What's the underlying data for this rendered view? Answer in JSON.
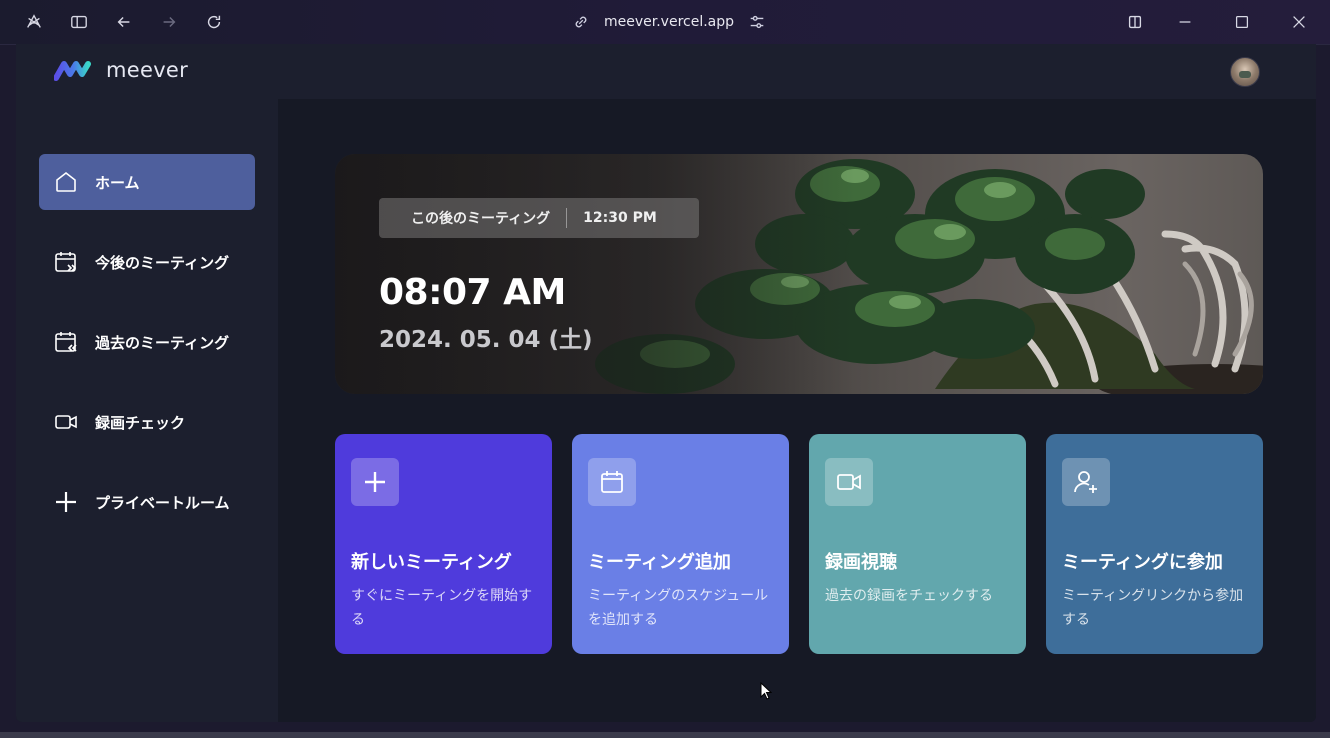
{
  "browser": {
    "url": "meever.vercel.app"
  },
  "app": {
    "name": "meever",
    "brand_colors": [
      "#5b4ee6",
      "#3ad6c8"
    ]
  },
  "sidebar": {
    "items": [
      {
        "label": "ホーム",
        "icon": "home-icon",
        "active": true
      },
      {
        "label": "今後のミーティング",
        "icon": "calendar-forward-icon",
        "active": false
      },
      {
        "label": "過去のミーティング",
        "icon": "calendar-back-icon",
        "active": false
      },
      {
        "label": "録画チェック",
        "icon": "video-icon",
        "active": false
      },
      {
        "label": "プライベートルーム",
        "icon": "plus-icon",
        "active": false
      }
    ]
  },
  "hero": {
    "upcoming_label": "この後のミーティング",
    "upcoming_time": "12:30 PM",
    "current_time": "08:07 AM",
    "current_date": "2024. 05. 04 (土)"
  },
  "cards": [
    {
      "title": "新しいミーティング",
      "description": "すぐにミーティングを開始する",
      "icon": "plus-icon",
      "color": "#4f3bdc"
    },
    {
      "title": "ミーティング追加",
      "description": "ミーティングのスケジュールを追加する",
      "icon": "calendar-icon",
      "color": "#6a7fe6"
    },
    {
      "title": "録画視聴",
      "description": "過去の録画をチェックする",
      "icon": "video-icon",
      "color": "#62a7ad"
    },
    {
      "title": "ミーティングに参加",
      "description": "ミーティングリンクから参加する",
      "icon": "user-plus-icon",
      "color": "#3e6e9a"
    }
  ]
}
